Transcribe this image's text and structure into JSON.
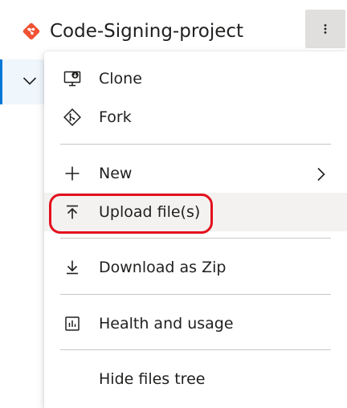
{
  "header": {
    "repo_name": "Code-Signing-project",
    "repo_icon": "git-repo-icon",
    "more_icon": "more-vertical-icon"
  },
  "tree": {
    "expand_icon": "chevron-down-icon"
  },
  "menu": {
    "items": [
      {
        "label": "Clone",
        "icon": "clone-monitor-icon"
      },
      {
        "label": "Fork",
        "icon": "fork-icon"
      },
      {
        "label": "New",
        "icon": "plus-icon",
        "submenu_icon": "chevron-right-icon"
      },
      {
        "label": "Upload file(s)",
        "icon": "upload-icon"
      },
      {
        "label": "Download as Zip",
        "icon": "download-icon"
      },
      {
        "label": "Health and usage",
        "icon": "health-chart-icon"
      },
      {
        "label": "Hide files tree",
        "icon": ""
      }
    ],
    "highlighted_item": "Upload file(s)"
  },
  "colors": {
    "accent": "#0078d4",
    "git_orange": "#f05133",
    "annotation_red": "#e3101d",
    "hover_bg": "#f3f2f1"
  }
}
